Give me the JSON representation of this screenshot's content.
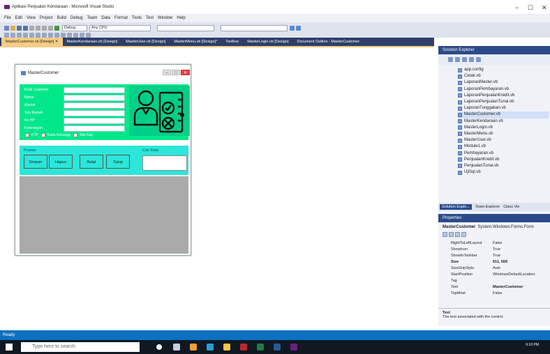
{
  "window": {
    "title": "Aplikasi Penjualan Kendaraan - Microsoft Visual Studio",
    "min": "−",
    "max": "☐",
    "close": "✕"
  },
  "menu": [
    "File",
    "Edit",
    "View",
    "Project",
    "Build",
    "Debug",
    "Team",
    "Data",
    "Format",
    "Tools",
    "Test",
    "Window",
    "Help"
  ],
  "toolbar": {
    "config": "Debug",
    "platform": "Any CPU"
  },
  "tabs": [
    "MasterCustomer.vb [Design]",
    "MasterKendaraan.vb [Design]",
    "MasterUser.vb [Design]",
    "MasterMenu.vb [Design]*",
    "Toolbox",
    "MasterLogin.vb [Design]",
    "Document Outline - MasterCustomer"
  ],
  "tab_close": "✕",
  "form": {
    "title": "MasterCustomer",
    "labels": [
      "Kode Customer",
      "Nama",
      "Alamat",
      "Telp Rumah",
      "No HP",
      "Keterangan"
    ],
    "checkboxes": [
      "KTP",
      "Kartu Keluarga",
      "Slip Gaji"
    ],
    "proses_label": "Proses",
    "buttons": [
      "Simpan",
      "Hapus",
      "Batal",
      "Tutup"
    ],
    "cari_label": "Cari Data"
  },
  "solution_explorer": {
    "title": "Solution Explorer",
    "files": [
      "app.config",
      "Cetak.vb",
      "LaporanMaster.vb",
      "LaporanPembayaran.vb",
      "LaporanPenjualanKredit.vb",
      "LaporanPenjualanTunai.vb",
      "LaporanTunggakan.vb",
      "MasterCustomer.vb",
      "MasterKendaraan.vb",
      "MasterLogin.vb",
      "MasterMenu.vb",
      "MasterUser.vb",
      "Module1.vb",
      "Pembayaran.vb",
      "PenjualanKredit.vb",
      "PenjualanTunai.vb",
      "UjiSql.vb"
    ],
    "selected": "MasterCustomer.vb",
    "tabs": [
      "Solution Explo...",
      "Team Explorer",
      "Class Vie"
    ]
  },
  "properties": {
    "title": "Properties",
    "object": "MasterCustomer",
    "type": "System.Windows.Forms.Form",
    "rows": [
      {
        "name": "RightToLeftLayout",
        "value": "False"
      },
      {
        "name": "ShowIcon",
        "value": "True"
      },
      {
        "name": "ShowInTaskbar",
        "value": "True"
      },
      {
        "name": "Size",
        "value": "611, 569"
      },
      {
        "name": "SizeGripStyle",
        "value": "Auto"
      },
      {
        "name": "StartPosition",
        "value": "WindowsDefaultLocation"
      },
      {
        "name": "Tag",
        "value": ""
      },
      {
        "name": "Text",
        "value": "MasterCustomer"
      },
      {
        "name": "TopMost",
        "value": "False"
      }
    ],
    "desc_title": "Text",
    "desc": "The text associated with the control."
  },
  "status": "Ready",
  "taskbar": {
    "search_placeholder": "Type here to search",
    "time": "6:10 PM"
  }
}
